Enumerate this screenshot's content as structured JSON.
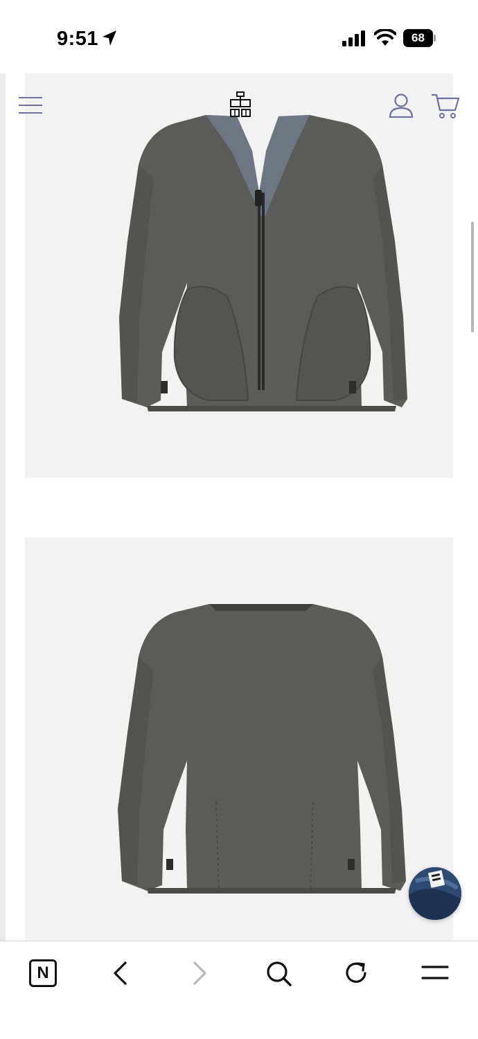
{
  "status_bar": {
    "time": "9:51",
    "battery": "68",
    "icons": [
      "location-arrow-icon",
      "cellular-signal-icon",
      "wifi-icon",
      "battery-icon"
    ]
  },
  "header": {
    "icons": [
      "hamburger-menu-icon",
      "brand-logo",
      "account-icon",
      "cart-icon"
    ],
    "icon_color": "#6a6fa0"
  },
  "gallery": {
    "images": [
      "jacket-front-image",
      "jacket-back-image"
    ],
    "panel_color": "#f2f2f2",
    "jacket_color": "#5b5c5a"
  },
  "chat": {
    "icon": "chat-bubble-icon"
  },
  "toolbar": {
    "n_label": "N",
    "icons": [
      "n-tab-icon",
      "back-icon",
      "forward-icon",
      "search-icon",
      "reload-icon",
      "menu-icon"
    ],
    "forward_disabled": true
  }
}
